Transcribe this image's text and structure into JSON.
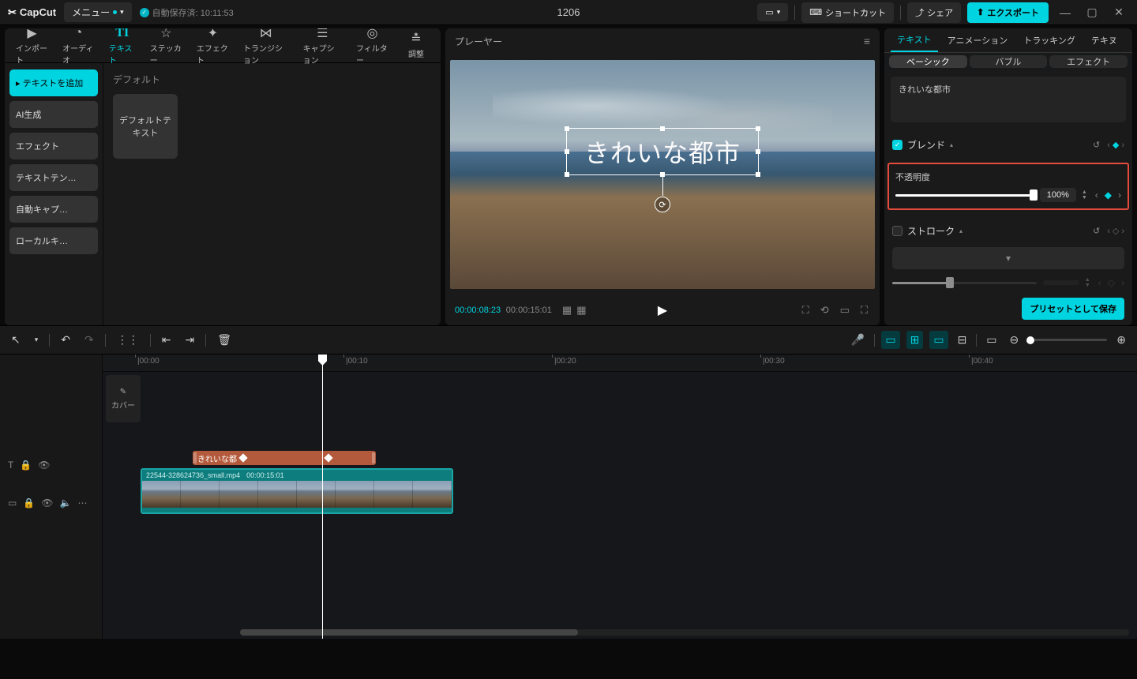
{
  "app_name": "CapCut",
  "menu_label": "メニュー",
  "auto_save": "自動保存済: 10:11:53",
  "project_title": "1206",
  "shortcuts_btn": "ショートカット",
  "share_btn": "シェア",
  "export_btn": "エクスポート",
  "main_tabs": {
    "import": "インポート",
    "audio": "オーディオ",
    "text": "テキスト",
    "sticker": "ステッカー",
    "effect": "エフェクト",
    "transition": "トランジション",
    "caption": "キャプション",
    "filter": "フィルター",
    "adjust": "調整"
  },
  "left_sidebar": {
    "add_text": "テキストを追加",
    "ai_gen": "AI生成",
    "effect": "エフェクト",
    "template": "テキストテン…",
    "auto_caption": "自動キャプ…",
    "local_key": "ローカルキ…"
  },
  "default_title": "デフォルト",
  "default_text_preset": "デフォルトテキスト",
  "preview_title": "プレーヤー",
  "overlay_text": "きれいな都市",
  "time_current": "00:00:08:23",
  "time_total": "00:00:15:01",
  "right_tabs": {
    "text": "テキスト",
    "animation": "アニメーション",
    "tracking": "トラッキング",
    "more": "テキヌ"
  },
  "sub_tabs": {
    "basic": "ベーシック",
    "bubble": "バブル",
    "effect": "エフェクト"
  },
  "text_value": "きれいな都市",
  "blend_label": "ブレンド",
  "opacity_label": "不透明度",
  "opacity_value": "100%",
  "stroke_label": "ストローク",
  "save_preset": "プリセットとして保存",
  "ruler": [
    "00:00",
    "00:10",
    "00:20",
    "00:30",
    "00:40"
  ],
  "timeline_cover": "カバー",
  "text_clip_label": "きれいな都",
  "video_clip_name": "22544-328624736_small.mp4",
  "video_clip_duration": "00:00:15:01"
}
